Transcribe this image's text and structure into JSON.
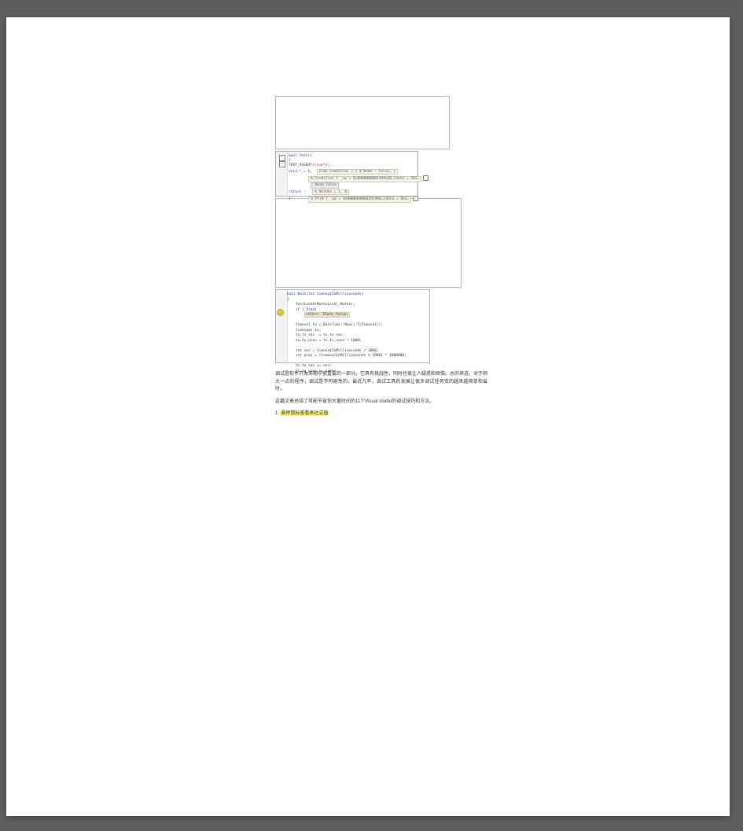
{
  "code1": {
    "l1": "bool Test()",
    "l2": "{",
    "l3_a": "TEST_ASSERT",
    "l3_b": "(true*3);",
    "l4_a": "void *",
    "l4_b": " = 1;",
    "pill_cond": "Item Condition = { 0_Node : false… }",
    "pill_vp": "m_Condition { _vp = 0x0000000004369e40…{data = 363…",
    "grey_node": "_Node   false",
    "pill_ptr": "m_NxtOne  = 1, 0",
    "pill_last": "m_Ptr0 { _vp = 0x0000000004455498…{data = 363…",
    "return": "return ;",
    "close": "}"
  },
  "code2": {
    "decl": "bool Wait(int timeoutInMilliseconds)",
    "open": "{",
    "l1": "    TestLockOrMutexLock(_Mutex);",
    "l2": "    if (_Pred)",
    "l3_pill": "return _State false;",
    "blank": "",
    "l4": "    timeval tv = DateTime::Now().ToTimeval();",
    "l5": "    timespec ts;",
    "l6": "    ts.tv_sec  = tv.tv_sec;",
    "l7": "    ts.tv_nsec = tv.tv_usec * 1000;",
    "l8": "    int sec = timeoutInMilliseconds / 1000;",
    "l9": "    int nsec = (timeoutInMilliseconds % 1000) * 1000000;",
    "l10": "    ts.tv_sec += sec;",
    "l11": "    ts.tv_nsec += nsec;"
  },
  "article": {
    "p1": "调试是软件开发周期中很重要的一部分。它具有挑战性，同时也很让人疑惑和烦恼。总的来说，对于稍大一点的程序，调试是不可避免的。最近几年，调试工具的发展让很多调试任务变的越来越简单和省时。",
    "p2_a": "这篇文章总结了可能节省你大量时间的11个",
    "p2_vs": "Visual studio",
    "p2_b": "的调试技巧和方法。",
    "h_num": "1",
    "h_text": "悬停鼠标查看表达式值"
  }
}
